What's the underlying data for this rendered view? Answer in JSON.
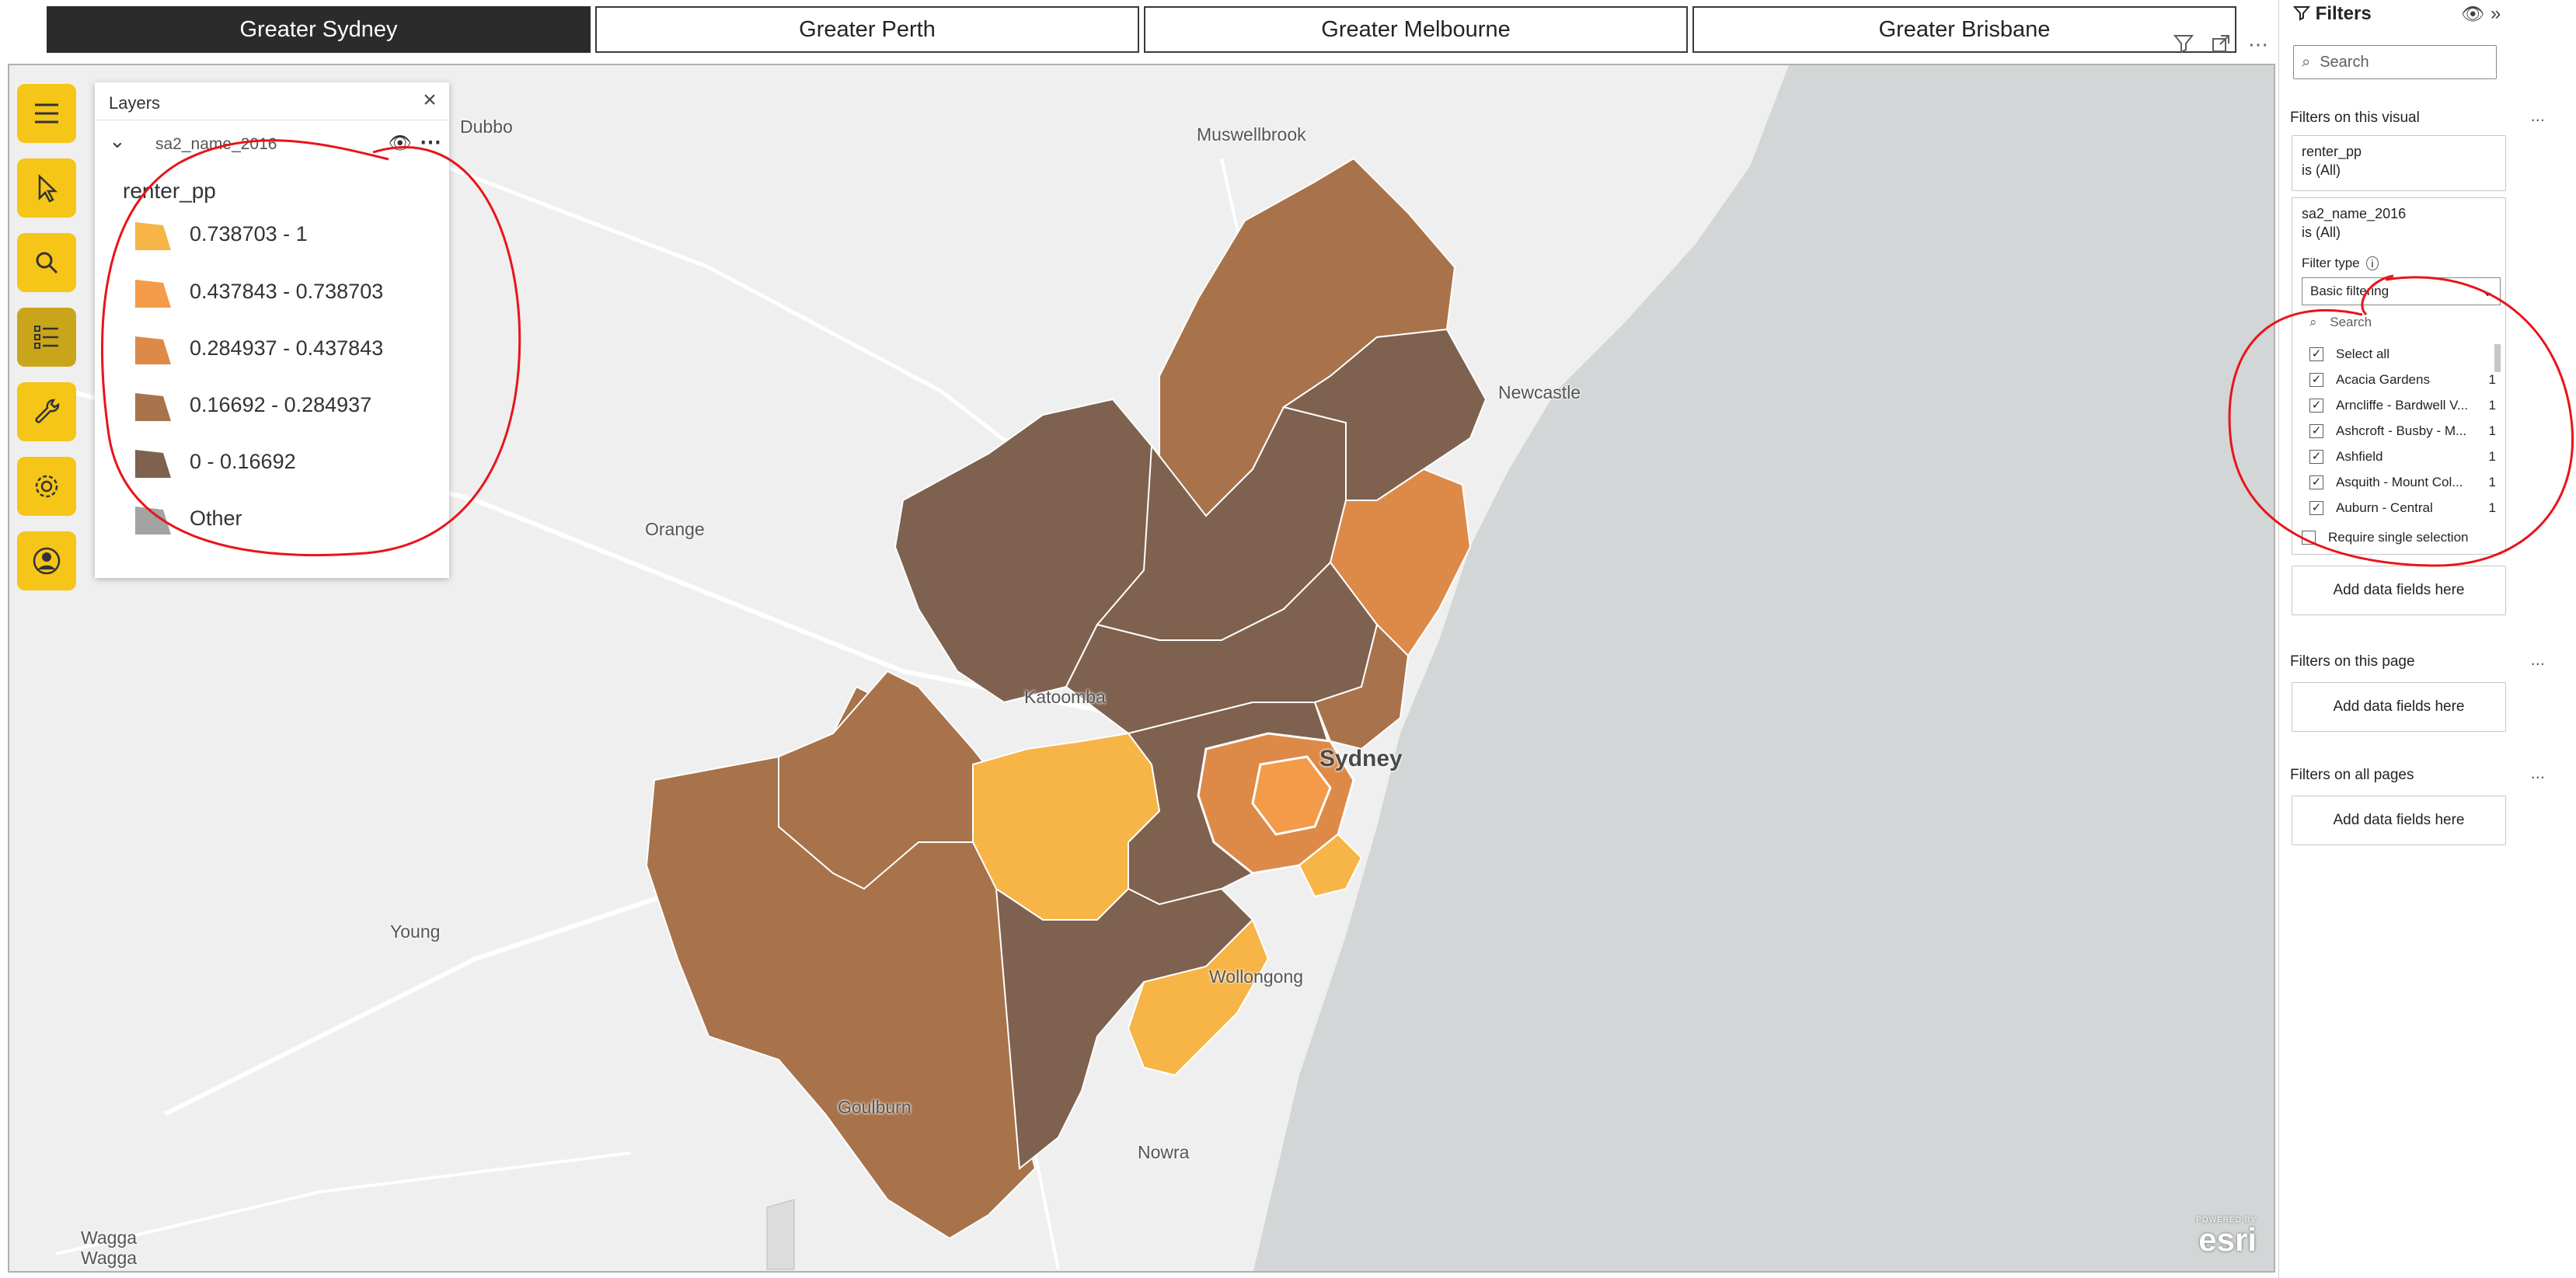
{
  "tabs": [
    {
      "label": "Greater Sydney",
      "active": true
    },
    {
      "label": "Greater Perth",
      "active": false
    },
    {
      "label": "Greater Melbourne",
      "active": false
    },
    {
      "label": "Greater Brisbane",
      "active": false
    }
  ],
  "layers_panel": {
    "title": "Layers",
    "layer_name": "sa2_name_2016",
    "field": "renter_pp",
    "legend": [
      {
        "label": "0.738703 - 1",
        "color": "#f6b546"
      },
      {
        "label": "0.437843 - 0.738703",
        "color": "#f39b48"
      },
      {
        "label": "0.284937 - 0.437843",
        "color": "#dd8a49"
      },
      {
        "label": "0.16692 - 0.284937",
        "color": "#a8734a"
      },
      {
        "label": "0 - 0.16692",
        "color": "#7f614f"
      },
      {
        "label": "Other",
        "color": "#a3a3a3"
      }
    ]
  },
  "map": {
    "places": [
      "Dubbo",
      "Muswellbrook",
      "Newcastle",
      "Orange",
      "Katoomba",
      "Sydney",
      "Young",
      "Wollongong",
      "Goulburn",
      "Nowra",
      "Wagga",
      "Wagga"
    ],
    "attribution_top": "POWERED BY",
    "attribution_brand": "esri"
  },
  "toolbar": {
    "tools": [
      "menu-icon",
      "select-arrow-icon",
      "search-icon",
      "legend-list-icon",
      "wrench-icon",
      "settings-gear-icon",
      "user-account-icon"
    ]
  },
  "filters": {
    "title": "Filters",
    "search_placeholder": "Search",
    "visual_section": "Filters on this visual",
    "card1": {
      "field": "renter_pp",
      "state": "is (All)"
    },
    "card2": {
      "field": "sa2_name_2016",
      "state": "is (All)",
      "filter_type_label": "Filter type",
      "filter_type_value": "Basic filtering",
      "search_placeholder": "Search"
    },
    "items": [
      {
        "label": "Select all",
        "count": ""
      },
      {
        "label": "Acacia Gardens",
        "count": "1"
      },
      {
        "label": "Arncliffe - Bardwell V...",
        "count": "1"
      },
      {
        "label": "Ashcroft - Busby - M...",
        "count": "1"
      },
      {
        "label": "Ashfield",
        "count": "1"
      },
      {
        "label": "Asquith - Mount Col...",
        "count": "1"
      },
      {
        "label": "Auburn - Central",
        "count": "1"
      }
    ],
    "require_single": "Require single selection",
    "add_fields": "Add data fields here",
    "page_section": "Filters on this page",
    "all_pages_section": "Filters on all pages",
    "more": "..."
  }
}
